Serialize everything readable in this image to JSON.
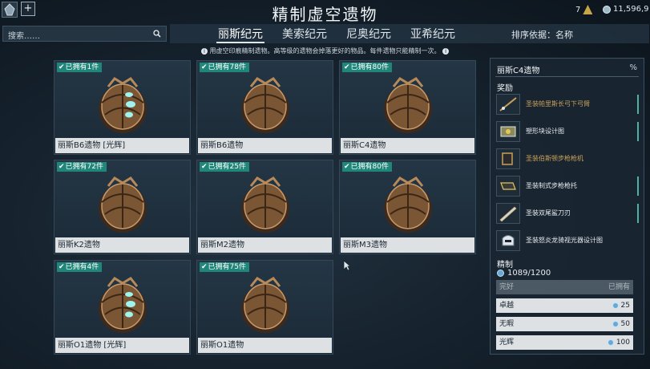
{
  "header": {
    "title": "精制虚空遗物",
    "add_label": "+",
    "ducats": "7",
    "credits": "11,596,9"
  },
  "search": {
    "placeholder": "搜索……"
  },
  "tabs": [
    {
      "label": "丽斯纪元",
      "active": true
    },
    {
      "label": "美索纪元",
      "active": false
    },
    {
      "label": "尼奥纪元",
      "active": false
    },
    {
      "label": "亚希纪元",
      "active": false
    }
  ],
  "sort": {
    "label": "排序依据：名称"
  },
  "info_text": "用虚空印痕精制遗物。高等级的遗物会掉落更好的物品。每件遗物只能精制一次。",
  "relics": [
    {
      "name": "丽斯B6遗物 [光辉]",
      "owned": "已拥有1件",
      "radiant": true
    },
    {
      "name": "丽斯B6遗物",
      "owned": "已拥有78件",
      "radiant": false
    },
    {
      "name": "丽斯C4遗物",
      "owned": "已拥有80件",
      "radiant": false
    },
    {
      "name": "丽斯K2遗物",
      "owned": "已拥有72件",
      "radiant": false
    },
    {
      "name": "丽斯M2遗物",
      "owned": "已拥有25件",
      "radiant": false
    },
    {
      "name": "丽斯M3遗物",
      "owned": "已拥有80件",
      "radiant": false
    },
    {
      "name": "丽斯O1遗物 [光辉]",
      "owned": "已拥有4件",
      "radiant": true
    },
    {
      "name": "丽斯O1遗物",
      "owned": "已拥有75件",
      "radiant": false
    }
  ],
  "detail": {
    "title": "丽斯C4遗物",
    "percent_label": "%",
    "rewards_label": "奖励",
    "rewards": [
      {
        "name": "圣装帕里斯长弓下弓臂",
        "color": "#c9a05a",
        "icon": "bow-limb-icon"
      },
      {
        "name": "塑形块设计图",
        "color": "#e8edf2",
        "icon": "forma-blueprint-icon"
      },
      {
        "name": "圣装伯斯顿步枪枪机",
        "color": "#c9a05a",
        "icon": "receiver-icon"
      },
      {
        "name": "圣装制式步枪枪托",
        "color": "#e8edf2",
        "icon": "stock-icon"
      },
      {
        "name": "圣装双尾鲨刀刃",
        "color": "#e8edf2",
        "icon": "blade-icon"
      },
      {
        "name": "圣装怒炎龙骑视光器设计图",
        "color": "#e8edf2",
        "icon": "helmet-blueprint-icon"
      }
    ],
    "refine_label": "精制",
    "void_traces": "1089/1200",
    "refine_header": {
      "name": "完好",
      "value": "已拥有"
    },
    "refine_options": [
      {
        "name": "卓越",
        "cost": "25"
      },
      {
        "name": "无暇",
        "cost": "50"
      },
      {
        "name": "光辉",
        "cost": "100"
      }
    ]
  }
}
